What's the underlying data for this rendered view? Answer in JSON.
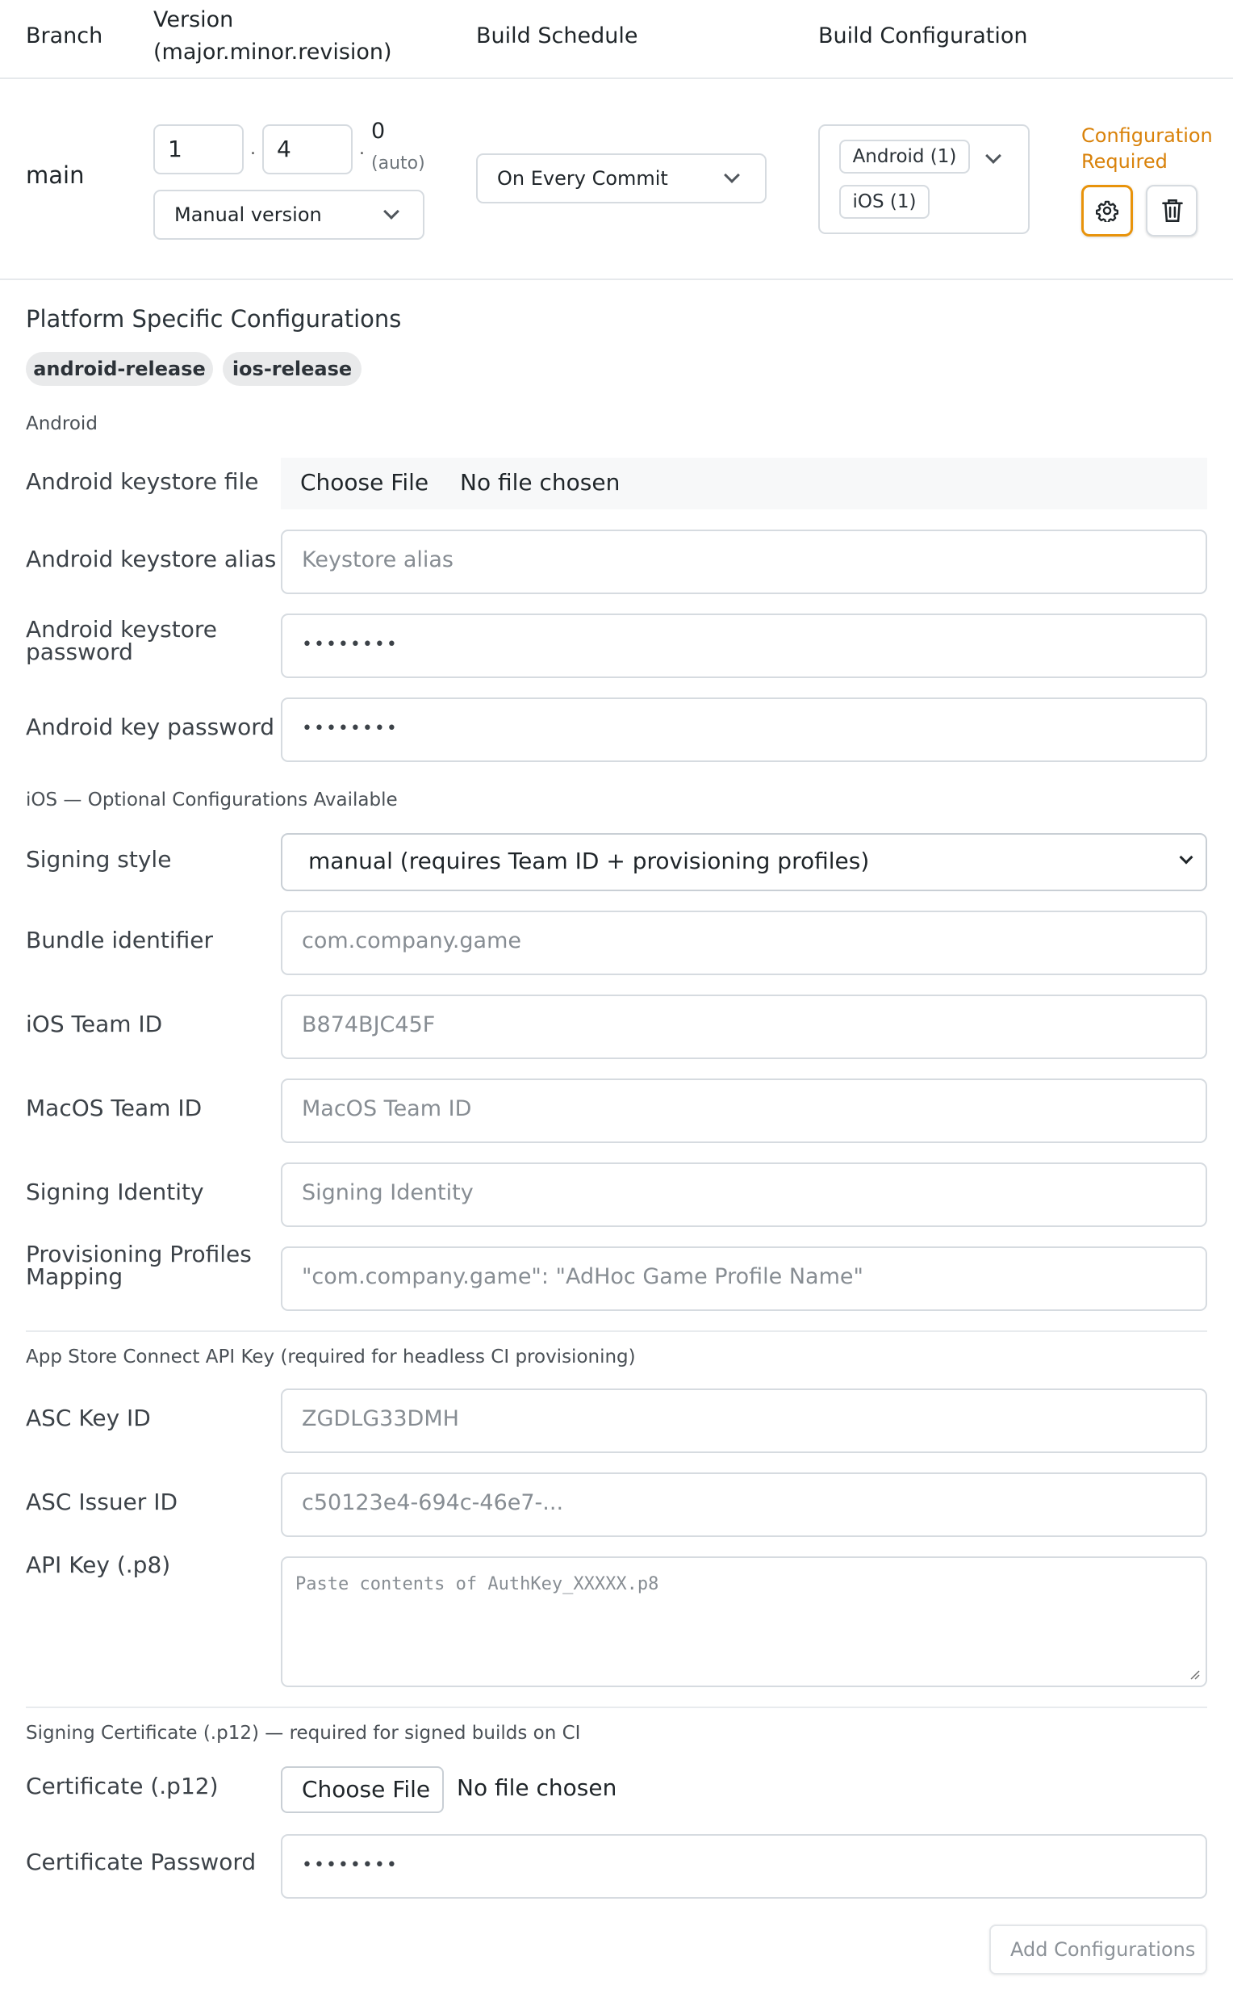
{
  "header": {
    "col_branch": "Branch",
    "col_version_1": "Version",
    "col_version_2": "(major.minor.revision)",
    "col_schedule": "Build Schedule",
    "col_config": "Build Configuration"
  },
  "row": {
    "branch": "main",
    "version_major": "1",
    "version_minor": "4",
    "version_revision": "0",
    "version_auto": "(auto)",
    "version_mode": "Manual version",
    "schedule": "On Every Commit",
    "config_chips": [
      "Android (1)",
      "iOS (1)"
    ],
    "warning_line1": "Configuration",
    "warning_line2": "Required"
  },
  "platform": {
    "title": "Platform Specific Configurations",
    "tabs": [
      "android-release",
      "ios-release"
    ]
  },
  "android": {
    "section": "Android",
    "keystore_file_label": "Android keystore file",
    "choose_file": "Choose File",
    "no_file": "No file chosen",
    "alias_label": "Android keystore alias",
    "alias_placeholder": "Keystore alias",
    "keystore_password_label_1": "Android keystore",
    "keystore_password_label_2": "password",
    "keystore_password_value": "••••••••",
    "key_password_label": "Android key password",
    "key_password_value": "••••••••"
  },
  "ios": {
    "section": "iOS — Optional Configurations Available",
    "signing_style_label": "Signing style",
    "signing_style_value": "manual (requires Team ID + provisioning profiles)",
    "bundle_label": "Bundle identifier",
    "bundle_placeholder": "com.company.game",
    "team_label": "iOS Team ID",
    "team_value": "B874BJC45F",
    "macos_team_label": "MacOS Team ID",
    "macos_team_placeholder": "MacOS Team ID",
    "identity_label": "Signing Identity",
    "identity_placeholder": "Signing Identity",
    "profiles_label_1": "Provisioning Profiles",
    "profiles_label_2": "Mapping",
    "profiles_placeholder": "\"com.company.game\": \"AdHoc Game Profile Name\""
  },
  "asc": {
    "section": "App Store Connect API Key (required for headless CI provisioning)",
    "key_id_label": "ASC Key ID",
    "key_id_value": "ZGDLG33DMH",
    "issuer_label": "ASC Issuer ID",
    "issuer_value": "c50123e4-694c-46e7-...",
    "api_key_label": "API Key (.p8)",
    "api_key_placeholder": "Paste contents of AuthKey_XXXXX.p8"
  },
  "cert": {
    "section": "Signing Certificate (.p12) — required for signed builds on CI",
    "cert_label": "Certificate (.p12)",
    "choose_file": "Choose File",
    "no_file": "No file chosen",
    "password_label": "Certificate Password",
    "password_value": "••••••••"
  },
  "footer": {
    "add_button": "Add Configurations"
  },
  "colors": {
    "accent": "#e8930b",
    "warning_text": "#d9820a"
  }
}
